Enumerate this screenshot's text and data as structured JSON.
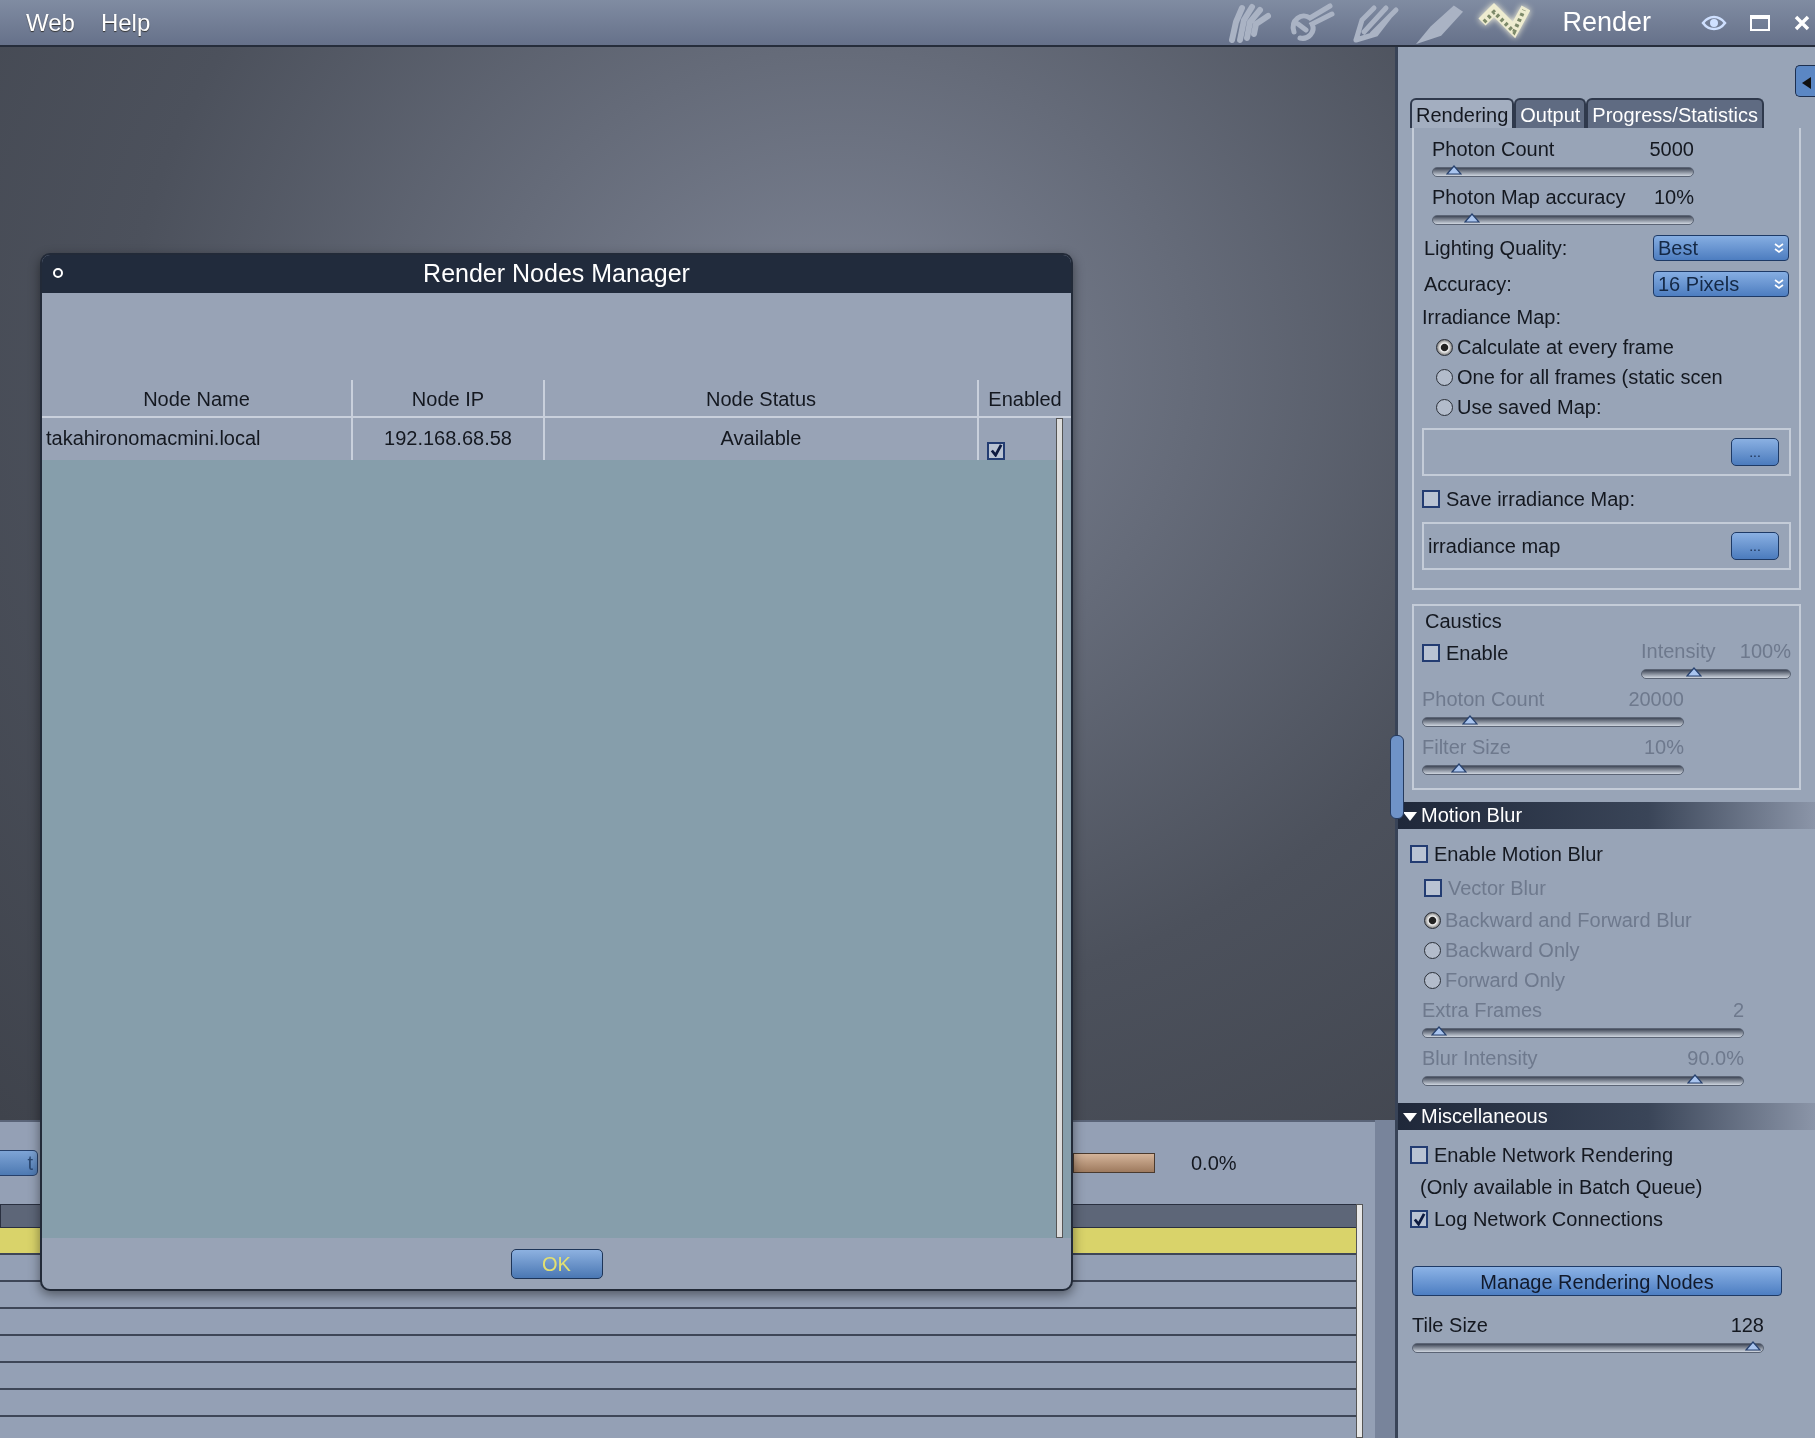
{
  "menu": [
    {
      "label": "Web"
    },
    {
      "label": "Help"
    }
  ],
  "rooms": [
    {
      "kind": "hand",
      "selected": false
    },
    {
      "kind": "tool",
      "selected": false
    },
    {
      "kind": "pencil",
      "selected": false
    },
    {
      "kind": "brush",
      "selected": false
    },
    {
      "kind": "film",
      "selected": true
    }
  ],
  "room_title": "Render",
  "dialog": {
    "title": "Render Nodes Manager",
    "columns": [
      "Node Name",
      "Node IP",
      "Node Status",
      "Enabled"
    ],
    "rows": [
      {
        "name": "takahironomacmini.local",
        "ip": "192.168.68.58",
        "status": "Available",
        "enabled": true
      }
    ],
    "ok": "OK"
  },
  "background": {
    "button": "t",
    "level": 0,
    "reading": "0.0%"
  },
  "panel": {
    "tabs": [
      {
        "label": "Rendering",
        "selected": true
      },
      {
        "label": "Output",
        "selected": false
      },
      {
        "label": "Progress/Statistics",
        "selected": false
      }
    ],
    "sections": [
      {
        "kind": "pane",
        "items": [
          {
            "kind": "slider",
            "label": "Photon Count",
            "reading": "5000",
            "level": 0.08,
            "disabled": false
          },
          {
            "kind": "slider",
            "label": "Photon Map accuracy",
            "reading": "10%",
            "level": 0.15,
            "disabled": false
          },
          {
            "kind": "select",
            "label": "Lighting Quality:",
            "value": "Best",
            "disabled": false
          },
          {
            "kind": "select",
            "label": "Accuracy:",
            "value": "16 Pixels",
            "disabled": false
          },
          {
            "kind": "label",
            "text": "Irradiance Map:",
            "disabled": false
          },
          {
            "kind": "radio",
            "text": "Calculate at every frame",
            "selected": true,
            "disabled": false
          },
          {
            "kind": "radio",
            "text": "One for all frames (static scen",
            "selected": false,
            "disabled": false
          },
          {
            "kind": "radio",
            "text": "Use saved Map:",
            "selected": false,
            "disabled": false
          },
          {
            "kind": "file",
            "browse": "...",
            "disabled": false
          },
          {
            "kind": "checkbox",
            "text": "Save irradiance Map:",
            "checked": false,
            "disabled": false
          },
          {
            "kind": "file",
            "value": "irradiance map",
            "browse": "...",
            "disabled": false
          }
        ]
      },
      {
        "kind": "group",
        "title": "Caustics",
        "items": [
          {
            "kind": "row",
            "items": [
              {
                "kind": "checkbox",
                "text": "Enable",
                "checked": false,
                "disabled": false
              },
              {
                "kind": "slider",
                "label": "Intensity",
                "reading": "100%",
                "level": 0.35,
                "disabled": true
              }
            ]
          },
          {
            "kind": "slider",
            "label": "Photon Count",
            "reading": "20000",
            "level": 0.18,
            "disabled": true
          },
          {
            "kind": "slider",
            "label": "Filter Size",
            "reading": "10%",
            "level": 0.14,
            "disabled": true
          }
        ]
      },
      {
        "kind": "collapsible",
        "title": "Motion Blur",
        "expanded": true,
        "items": [
          {
            "kind": "checkbox",
            "text": "Enable Motion Blur",
            "checked": false,
            "disabled": false
          },
          {
            "kind": "checkbox",
            "text": "Vector Blur",
            "checked": false,
            "disabled": true,
            "indent": true
          },
          {
            "kind": "radio",
            "text": "Backward and Forward Blur",
            "selected": true,
            "disabled": true
          },
          {
            "kind": "radio",
            "text": "Backward Only",
            "selected": false,
            "disabled": true
          },
          {
            "kind": "radio",
            "text": "Forward Only",
            "selected": false,
            "disabled": true
          },
          {
            "kind": "slider",
            "label": "Extra Frames",
            "reading": "2",
            "level": 0.05,
            "disabled": true
          },
          {
            "kind": "slider",
            "label": "Blur Intensity",
            "reading": "90.0%",
            "level": 0.85,
            "disabled": true
          }
        ]
      },
      {
        "kind": "collapsible",
        "title": "Miscellaneous",
        "expanded": true,
        "items": [
          {
            "kind": "checkbox",
            "text": "Enable Network Rendering",
            "checked": false,
            "disabled": false
          },
          {
            "kind": "note",
            "text": "(Only available in Batch Queue)",
            "disabled": false
          },
          {
            "kind": "checkbox",
            "text": "Log Network Connections",
            "checked": true,
            "disabled": false
          },
          {
            "kind": "button",
            "text": "Manage Rendering Nodes",
            "disabled": false
          },
          {
            "kind": "slider",
            "label": "Tile Size",
            "reading": "128",
            "level": 0.97,
            "disabled": false
          }
        ]
      }
    ]
  }
}
